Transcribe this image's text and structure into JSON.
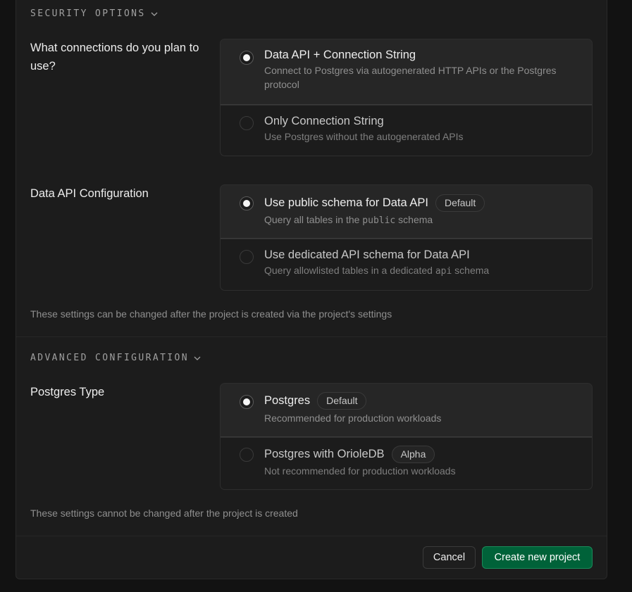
{
  "security": {
    "header": "SECURITY OPTIONS",
    "connections": {
      "question": "What connections do you plan to use?",
      "options": [
        {
          "title": "Data API + Connection String",
          "desc": "Connect to Postgres via autogenerated HTTP APIs or the Postgres protocol",
          "selected": true
        },
        {
          "title": "Only Connection String",
          "desc": "Use Postgres without the autogenerated APIs",
          "selected": false
        }
      ]
    },
    "data_api": {
      "question": "Data API Configuration",
      "options": [
        {
          "title": "Use public schema for Data API",
          "badge": "Default",
          "desc_pre": "Query all tables in the ",
          "desc_code": "public",
          "desc_post": " schema",
          "selected": true
        },
        {
          "title": "Use dedicated API schema for Data API",
          "desc_pre": "Query allowlisted tables in a dedicated ",
          "desc_code": "api",
          "desc_post": " schema",
          "selected": false
        }
      ]
    },
    "note": "These settings can be changed after the project is created via the project's settings"
  },
  "advanced": {
    "header": "ADVANCED CONFIGURATION",
    "postgres_type": {
      "question": "Postgres Type",
      "options": [
        {
          "title": "Postgres",
          "badge": "Default",
          "desc": "Recommended for production workloads",
          "selected": true
        },
        {
          "title": "Postgres with OrioleDB",
          "badge": "Alpha",
          "desc": "Not recommended for production workloads",
          "selected": false
        }
      ]
    },
    "note": "These settings cannot be changed after the project is created"
  },
  "footer": {
    "cancel_label": "Cancel",
    "create_label": "Create new project"
  },
  "colors": {
    "background": "#121212",
    "panel": "#1c1c1c",
    "primary_button": "#006239"
  }
}
